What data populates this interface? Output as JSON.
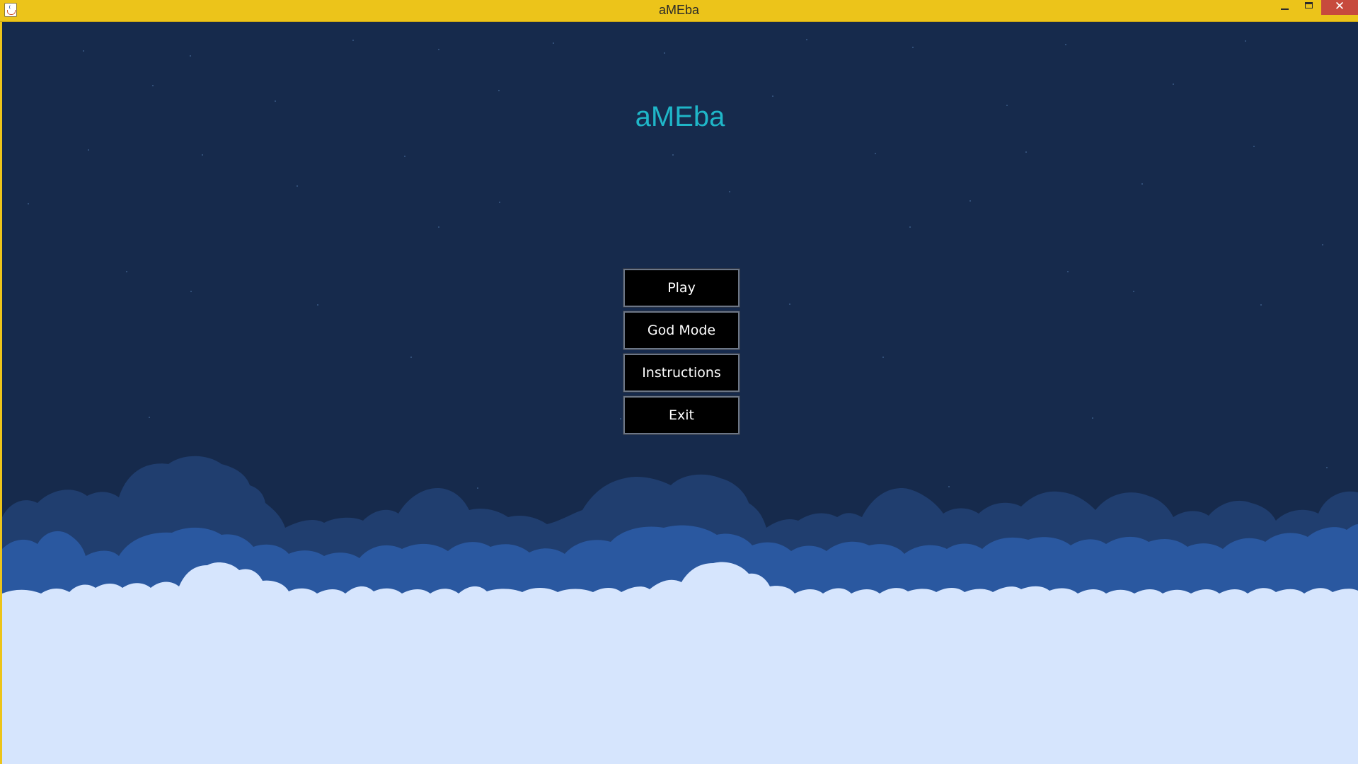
{
  "window": {
    "title": "aMEba",
    "icon": "java-cup-icon",
    "controls": {
      "minimize": "minimize-icon",
      "maximize": "maximize-icon",
      "close_glyph": "✕"
    },
    "titlebar_color": "#ecc41a"
  },
  "game": {
    "title": "aMEba",
    "title_color": "#1fb6c8",
    "background_color": "#162a4c",
    "cloud_colors": {
      "back": "#203e6f",
      "middle": "#2a58a0",
      "front": "#d6e5fd"
    }
  },
  "menu": {
    "play_label": "Play",
    "god_mode_label": "God Mode",
    "instructions_label": "Instructions",
    "exit_label": "Exit"
  }
}
